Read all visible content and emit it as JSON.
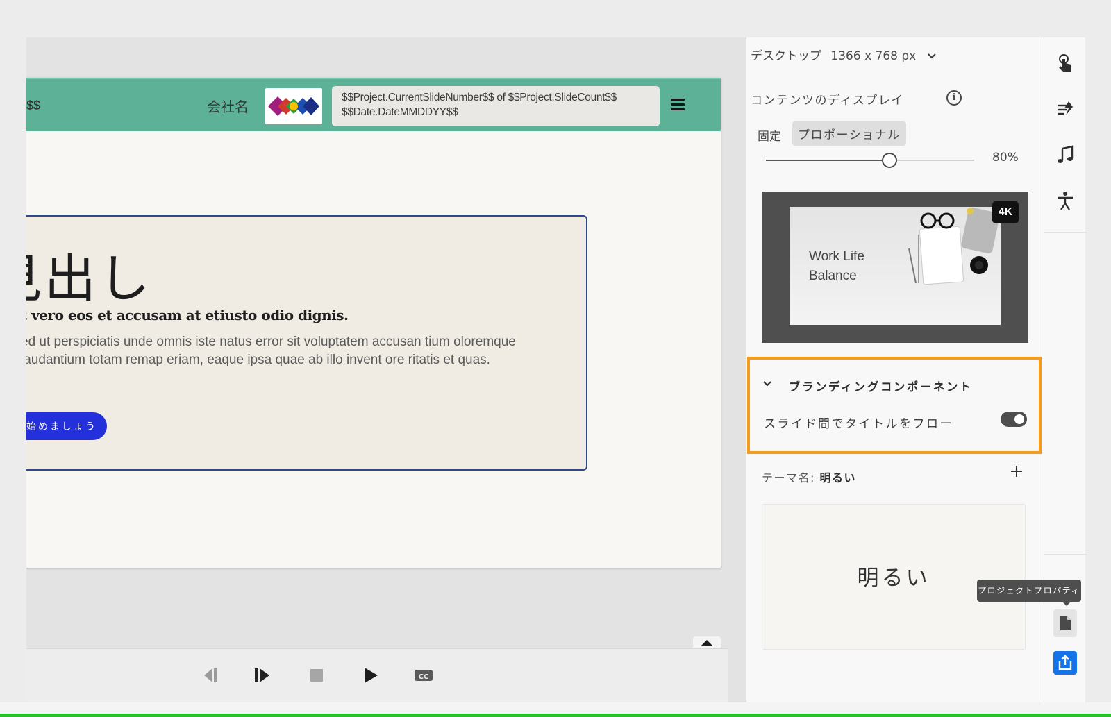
{
  "slide": {
    "header": {
      "partial_text": "$$",
      "company_name": "会社名",
      "variables_line1": "$$Project.CurrentSlideNumber$$ of $$Project.SlideCount$$",
      "variables_line2": "$$Date.DateMMDDYY$$"
    },
    "card": {
      "title": "見出し",
      "subtitle": "t vero eos et accusam at etiusto odio dignis.",
      "body": "ed ut perspiciatis unde omnis iste natus error sit voluptatem accusan tium oloremque laudantium totam remap eriam, eaque ipsa quae ab illo invent ore ritatis et quas.",
      "button_label": "始めましょう"
    }
  },
  "playbar": {
    "icons": [
      "previous-icon",
      "next-icon",
      "stop-icon",
      "play-icon",
      "closed-caption-icon"
    ]
  },
  "panel": {
    "device_label": "デスクトップ",
    "device_size": "1366 x 768 px",
    "content_display_label": "コンテンツのディスプレイ",
    "mode_fixed": "固定",
    "mode_proportional": "プロポーショナル",
    "active_mode": "proportional",
    "scale_value": "80%",
    "scale_fraction": 0.8,
    "preview": {
      "thumb_title": "Work Life Balance",
      "badge": "4K"
    },
    "branding": {
      "section_title": "ブランディングコンポーネント",
      "flow_title_label": "スライド間でタイトルをフロー",
      "flow_title_enabled": true,
      "highlight_color": "#f59b1e"
    },
    "theme": {
      "label": "テーマ名:",
      "name": "明るい",
      "card_text": "明るい"
    }
  },
  "rail": {
    "icons": [
      "touch-icon",
      "transition-icon",
      "music-icon",
      "accessibility-icon",
      "document-icon",
      "publish-icon"
    ],
    "tooltip": "プロジェクトプロパティ",
    "accent_color": "#1473e6"
  },
  "colors": {
    "header_bg": "#5db197",
    "card_border": "#2d4a8a",
    "cta_button": "#2430d9"
  }
}
